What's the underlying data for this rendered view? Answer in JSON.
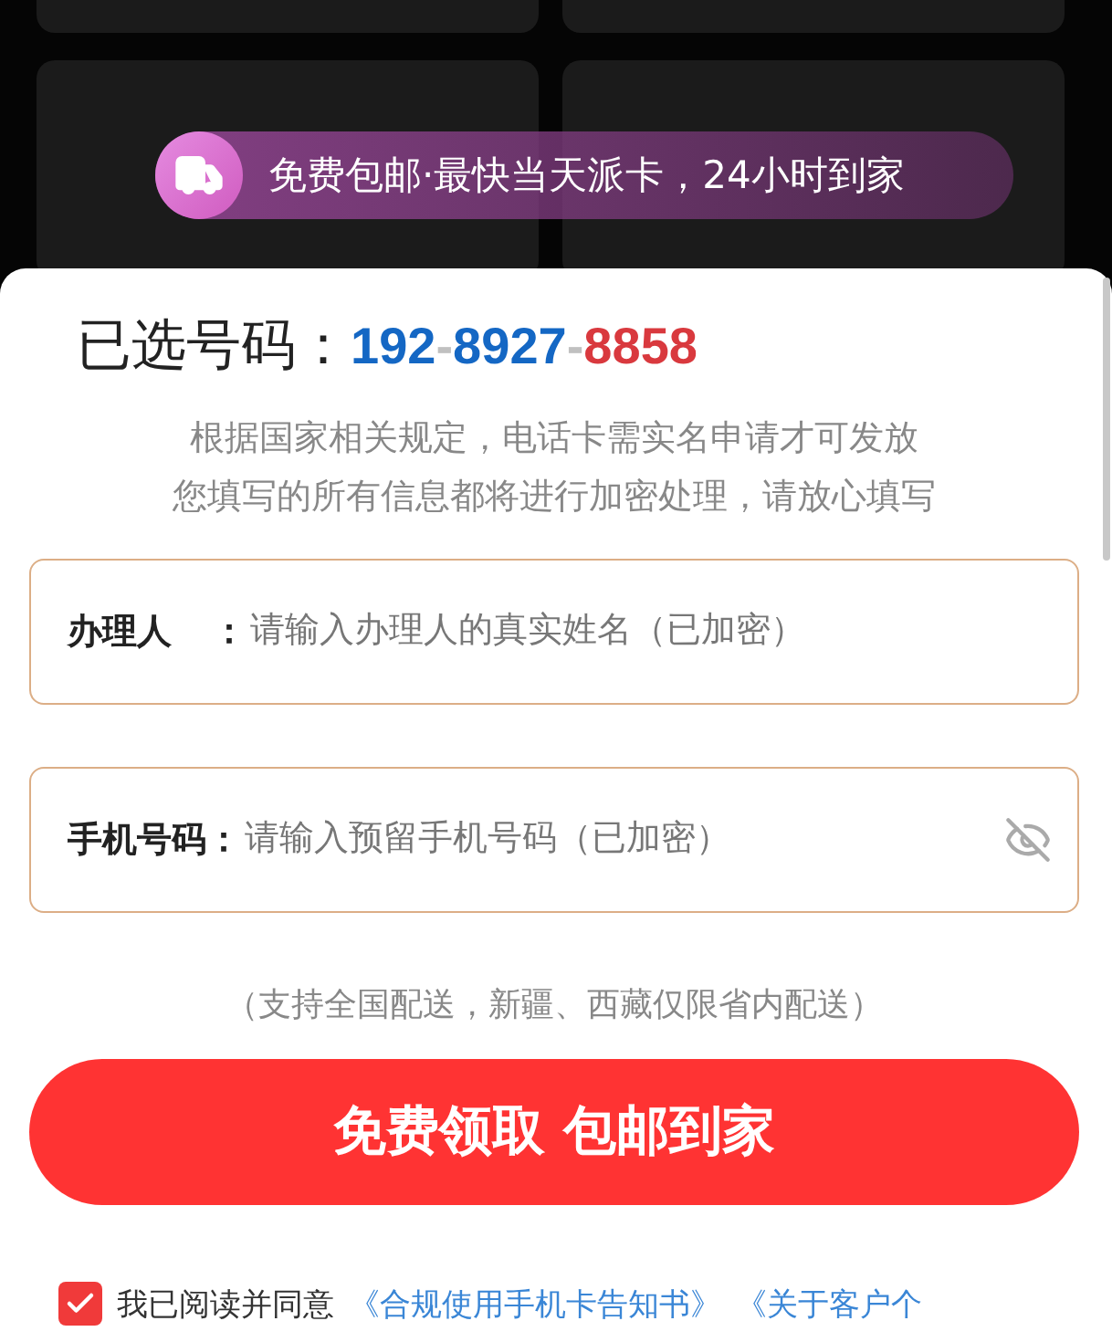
{
  "banner": {
    "text": "免费包邮·最快当天派卡，24小时到家"
  },
  "sheet": {
    "title_label": "已选号码：",
    "number": [
      {
        "text": "192",
        "color": "#1467c4"
      },
      {
        "text": "-",
        "color": "#c0c0c0"
      },
      {
        "text": "8927",
        "color": "#1467c4"
      },
      {
        "text": "-",
        "color": "#c0c0c0"
      },
      {
        "text": "8858",
        "color": "#d9393e"
      }
    ],
    "notice": [
      "根据国家相关规定，电话卡需实名申请才可发放",
      "您填写的所有信息都将进行加密处理，请放心填写"
    ],
    "fields": [
      {
        "kind": "text",
        "label": "办理人",
        "colon": "：",
        "placeholder": "请输入办理人的真实姓名（已加密）"
      },
      {
        "kind": "password",
        "label": "手机号码",
        "colon": "：",
        "placeholder": "请输入预留手机号码（已加密）"
      }
    ],
    "delivery_note": "（支持全国配送，新疆、西藏仅限省内配送）",
    "submit_button": "免费领取 包邮到家",
    "agreement": {
      "checked": true,
      "text": "我已阅读并同意",
      "links": [
        "《合规使用手机卡告知书》",
        "《关于客户个"
      ]
    }
  }
}
